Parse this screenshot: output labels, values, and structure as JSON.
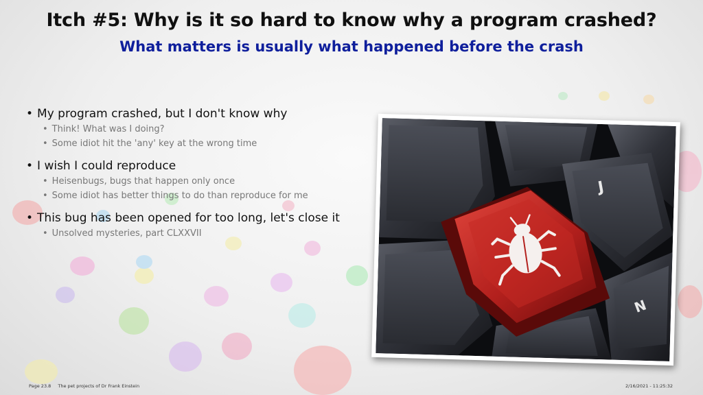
{
  "slide": {
    "title": "Itch #5: Why is it so hard to know why a program crashed?",
    "subtitle": "What matters is usually what happened before the crash"
  },
  "bullets": [
    {
      "text": "My program crashed, but I don't know why",
      "sub": [
        "Think! What was I doing?",
        "Some idiot hit the 'any' key at the wrong time"
      ]
    },
    {
      "text": "I wish I could reproduce",
      "sub": [
        "Heisenbugs, bugs that happen only once",
        "Some idiot has better things to do than reproduce for me"
      ]
    },
    {
      "text": "This bug has been opened for too long, let's close it",
      "sub": [
        "Unsolved mysteries, part CLXXVII"
      ]
    }
  ],
  "image": {
    "icon": "bug-icon",
    "key_labels": [
      "J",
      "N"
    ],
    "key_color": "#b3201d"
  },
  "footer": {
    "page": "Page 23.8",
    "project": "The pet projects of Dr Frank Einstein",
    "datetime": "2/16/2021 - 11:25:32"
  }
}
